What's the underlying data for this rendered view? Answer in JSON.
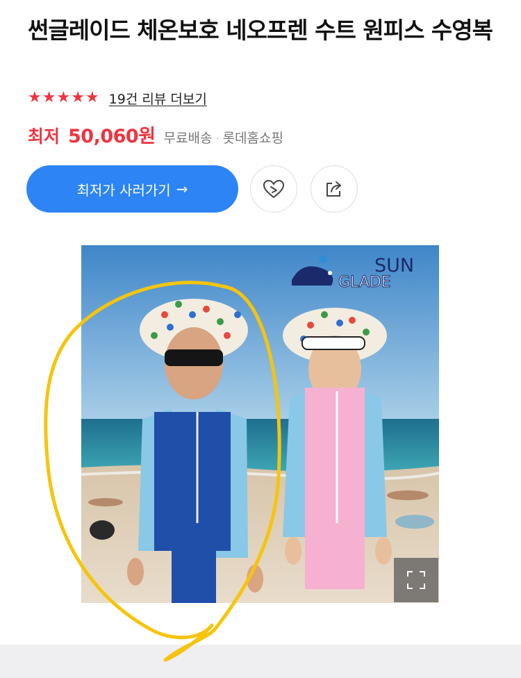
{
  "product": {
    "title": "썬글레이드 체온보호 네오프렌 수트 원피스 수영복",
    "rating_stars": 5,
    "review_link": "19건 리뷰 더보기"
  },
  "price": {
    "label": "최저",
    "value": "50,060원",
    "shipping": "무료배송",
    "separator": "·",
    "seller": "롯데홈쇼핑"
  },
  "actions": {
    "buy_label": "최저가 사러가기",
    "buy_arrow": "→",
    "like_icon": "heart-icon",
    "share_icon": "share-icon"
  },
  "image": {
    "brand_line1": "SUN",
    "brand_line2": "GLADE",
    "expand_icon": "expand-icon"
  },
  "colors": {
    "accent_red": "#f0343f",
    "button_blue": "#2d84f5",
    "annotation_yellow": "#f6c40d"
  }
}
